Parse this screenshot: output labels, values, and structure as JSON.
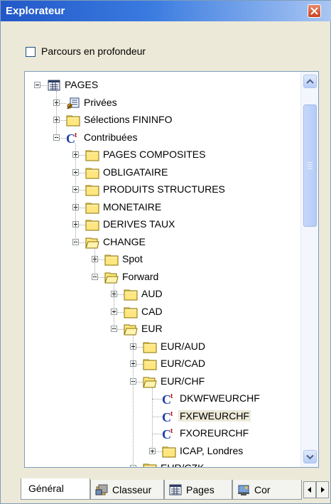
{
  "window": {
    "title": "Explorateur"
  },
  "options": {
    "depth_label": "Parcours en profondeur",
    "depth_checked": false
  },
  "tree": [
    {
      "label": "PAGES",
      "icon": "pages-icon",
      "expander": "minus"
    },
    {
      "label": "Privées",
      "icon": "private-icon",
      "expander": "plus"
    },
    {
      "label": "Sélections FININFO",
      "icon": "folder-icon",
      "expander": "plus"
    },
    {
      "label": "Contribuées",
      "icon": "contrib-icon",
      "expander": "minus"
    },
    {
      "label": "PAGES COMPOSITES",
      "icon": "folder-icon",
      "expander": "plus"
    },
    {
      "label": "OBLIGATAIRE",
      "icon": "folder-icon",
      "expander": "plus"
    },
    {
      "label": "PRODUITS STRUCTURES",
      "icon": "folder-icon",
      "expander": "plus"
    },
    {
      "label": "MONETAIRE",
      "icon": "folder-icon",
      "expander": "plus"
    },
    {
      "label": "DERIVES TAUX",
      "icon": "folder-icon",
      "expander": "plus"
    },
    {
      "label": "CHANGE",
      "icon": "open-folder-icon",
      "expander": "minus"
    },
    {
      "label": "Spot",
      "icon": "folder-icon",
      "expander": "plus"
    },
    {
      "label": "Forward",
      "icon": "open-folder-icon",
      "expander": "minus"
    },
    {
      "label": "AUD",
      "icon": "folder-icon",
      "expander": "plus"
    },
    {
      "label": "CAD",
      "icon": "folder-icon",
      "expander": "plus"
    },
    {
      "label": "EUR",
      "icon": "open-folder-icon",
      "expander": "minus"
    },
    {
      "label": "EUR/AUD",
      "icon": "folder-icon",
      "expander": "plus"
    },
    {
      "label": "EUR/CAD",
      "icon": "folder-icon",
      "expander": "plus"
    },
    {
      "label": "EUR/CHF",
      "icon": "open-folder-icon",
      "expander": "minus"
    },
    {
      "label": "DKWFWEURCHF",
      "icon": "contrib-icon",
      "expander": "none"
    },
    {
      "label": "FXFWEURCHF",
      "icon": "contrib-icon",
      "expander": "none",
      "selected": true
    },
    {
      "label": "FXOREURCHF",
      "icon": "contrib-icon",
      "expander": "none"
    },
    {
      "label": "ICAP, Londres",
      "icon": "folder-icon",
      "expander": "plus"
    },
    {
      "label": "EUR/CZK",
      "icon": "folder-icon",
      "expander": "plus"
    }
  ],
  "tabs": [
    {
      "label": "Général",
      "icon": "none",
      "active": true
    },
    {
      "label": "Classeur",
      "icon": "binder-icon"
    },
    {
      "label": "Pages",
      "icon": "pages-icon"
    },
    {
      "label": "Cor",
      "icon": "contrib-tab-icon"
    }
  ]
}
